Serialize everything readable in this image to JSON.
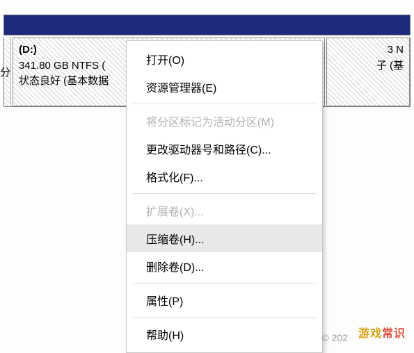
{
  "partition_left_sliver_char": "分",
  "partition_d": {
    "name": "(D:)",
    "info": "341.80 GB NTFS (",
    "status": "状态良好 (基本数据"
  },
  "partition_right": {
    "name": "",
    "info": "3 N",
    "status": "子 (基"
  },
  "menu": {
    "items": [
      {
        "label": "打开(O)",
        "disabled": false,
        "hover": false
      },
      {
        "label": "资源管理器(E)",
        "disabled": false,
        "hover": false
      }
    ],
    "items2": [
      {
        "label": "将分区标记为活动分区(M)",
        "disabled": true,
        "hover": false
      },
      {
        "label": "更改驱动器号和路径(C)...",
        "disabled": false,
        "hover": false
      },
      {
        "label": "格式化(F)...",
        "disabled": false,
        "hover": false
      }
    ],
    "items3": [
      {
        "label": "扩展卷(X)...",
        "disabled": true,
        "hover": false
      },
      {
        "label": "压缩卷(H)...",
        "disabled": false,
        "hover": true
      },
      {
        "label": "删除卷(D)...",
        "disabled": false,
        "hover": false
      }
    ],
    "items4": [
      {
        "label": "属性(P)",
        "disabled": false,
        "hover": false
      }
    ],
    "items5": [
      {
        "label": "帮助(H)",
        "disabled": false,
        "hover": false
      }
    ]
  },
  "footer_year_prefix": "© 202",
  "watermark_a": "游戏",
  "watermark_b": "常识"
}
